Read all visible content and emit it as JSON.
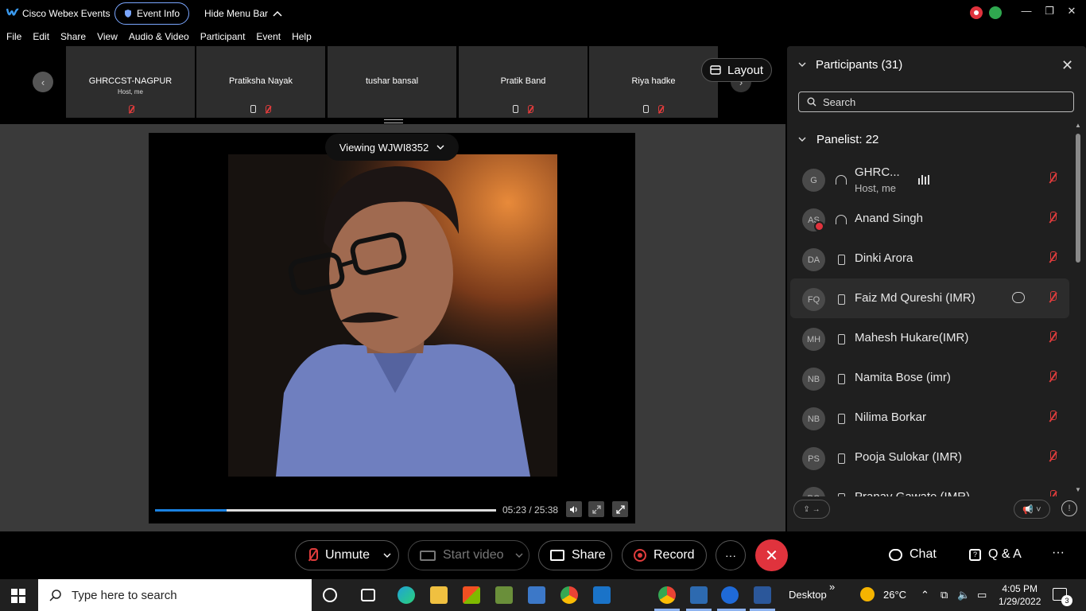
{
  "titlebar": {
    "app_name": "Cisco Webex Events",
    "event_info_label": "Event Info",
    "hide_menu_label": "Hide Menu Bar",
    "minimize": "—",
    "restore": "❐",
    "close": "✕"
  },
  "menu": {
    "items": [
      "File",
      "Edit",
      "Share",
      "View",
      "Audio & Video",
      "Participant",
      "Event",
      "Help"
    ]
  },
  "filmstrip": {
    "tiles": [
      {
        "name": "GHRCCST-NAGPUR",
        "role": "Host, me"
      },
      {
        "name": "Pratiksha Nayak",
        "role": ""
      },
      {
        "name": "tushar bansal",
        "role": ""
      },
      {
        "name": "Pratik Band",
        "role": ""
      },
      {
        "name": "Riya hadke",
        "role": ""
      }
    ],
    "layout_label": "Layout"
  },
  "video": {
    "viewing_label": "Viewing WJWI8352",
    "time_label": "05:23 / 25:38",
    "progress_fraction": 0.21
  },
  "panel": {
    "title": "Participants (31)",
    "search_placeholder": "Search",
    "group_title": "Panelist: 22",
    "participants": [
      {
        "initials": "G",
        "name": "GHRC...",
        "role": "Host, me",
        "device": "headset",
        "speaking": true
      },
      {
        "initials": "AS",
        "name": "Anand Singh",
        "role": "",
        "device": "headset"
      },
      {
        "initials": "DA",
        "name": "Dinki Arora",
        "role": "",
        "device": "phone"
      },
      {
        "initials": "FQ",
        "name": "Faiz Md Qureshi (IMR)",
        "role": "",
        "device": "phone",
        "hover": true
      },
      {
        "initials": "MH",
        "name": "Mahesh Hukare(IMR)",
        "role": "",
        "device": "phone"
      },
      {
        "initials": "NB",
        "name": "Namita Bose (imr)",
        "role": "",
        "device": "phone"
      },
      {
        "initials": "NB",
        "name": "Nilima Borkar",
        "role": "",
        "device": "phone"
      },
      {
        "initials": "PS",
        "name": "Pooja Sulokar (IMR)",
        "role": "",
        "device": "phone"
      },
      {
        "initials": "PG",
        "name": "Pranav Gawate (IMR)",
        "role": "",
        "device": "phone"
      }
    ]
  },
  "controls": {
    "unmute": "Unmute",
    "start_video": "Start video",
    "share": "Share",
    "record": "Record",
    "more": "···",
    "end": "✕",
    "chat": "Chat",
    "qa": "Q & A",
    "overflow": "···"
  },
  "taskbar": {
    "search_placeholder": "Type here to search",
    "desktop_label": "Desktop",
    "weather": "26°C",
    "time": "4:05 PM",
    "date": "1/29/2022",
    "notification_count": "3"
  },
  "colors": {
    "accent_blue": "#1a82e2",
    "mute_red": "#e03c3c",
    "end_red": "#e0333d",
    "panel_bg": "#1f1f1f"
  }
}
